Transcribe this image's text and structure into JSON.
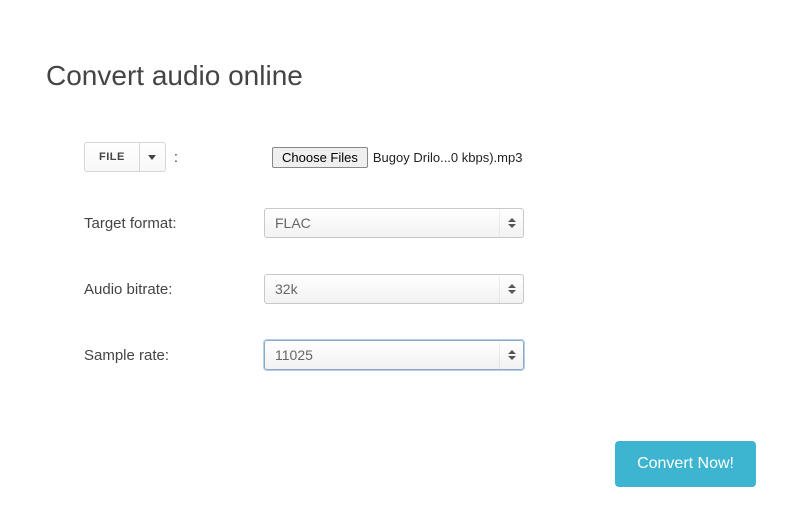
{
  "title": "Convert audio online",
  "file": {
    "button_label": "FILE",
    "colon": ":",
    "choose_label": "Choose Files",
    "selected_filename": "Bugoy Drilo...0 kbps).mp3"
  },
  "fields": {
    "target_format": {
      "label": "Target format:",
      "value": "FLAC"
    },
    "audio_bitrate": {
      "label": "Audio bitrate:",
      "value": "32k"
    },
    "sample_rate": {
      "label": "Sample rate:",
      "value": "11025"
    }
  },
  "submit": {
    "label": "Convert Now!"
  }
}
